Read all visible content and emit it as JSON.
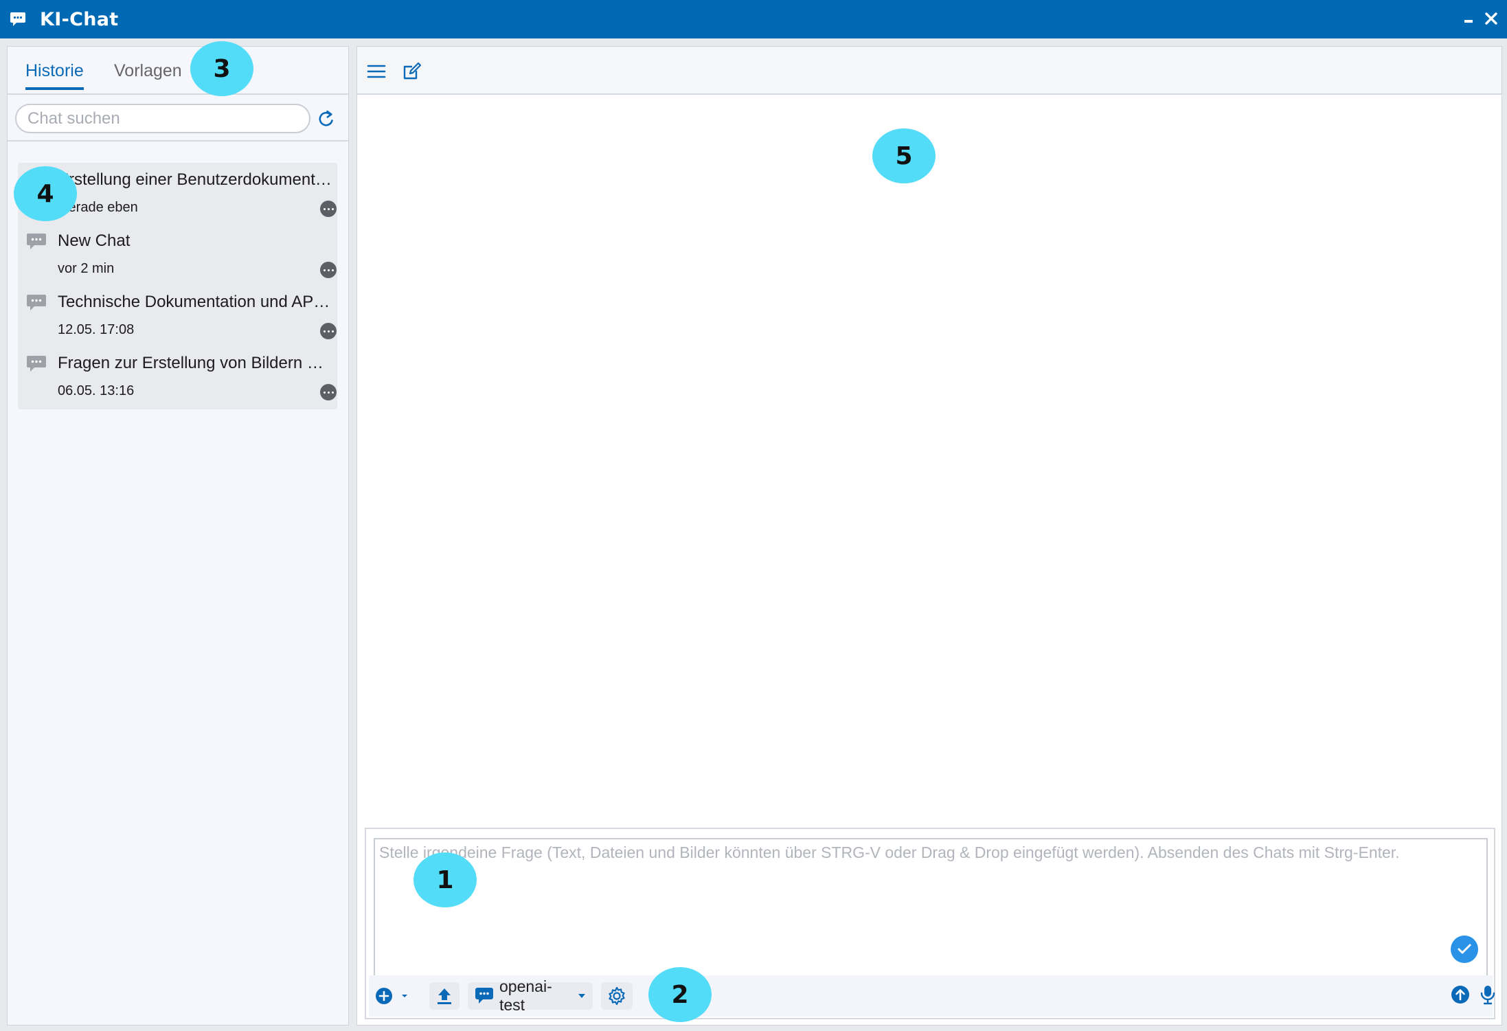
{
  "window": {
    "title": "KI-Chat",
    "app_icon": "chat-bubble-icon",
    "minimize_icon": "minimize-icon",
    "close_icon": "close-icon",
    "accent_color": "#0069b4"
  },
  "sidebar": {
    "tabs": [
      {
        "label": "Historie",
        "active": true
      },
      {
        "label": "Vorlagen",
        "active": false
      }
    ],
    "search": {
      "placeholder": "Chat suchen",
      "value": ""
    },
    "refresh_icon": "refresh-icon",
    "chats": [
      {
        "title": "Erstellung einer Benutzerdokumentation",
        "time": "Gerade eben",
        "icon": "chat-bubble-icon"
      },
      {
        "title": "New Chat",
        "time": "vor 2 min",
        "icon": "chat-bubble-icon"
      },
      {
        "title": "Technische Dokumentation und API-Referenz",
        "time": "12.05. 17:08",
        "icon": "chat-bubble-icon"
      },
      {
        "title": "Fragen zur Erstellung von Bildern mit KI",
        "time": "06.05. 13:16",
        "icon": "chat-bubble-icon"
      }
    ]
  },
  "main": {
    "toolbar": {
      "menu_icon": "hamburger-menu-icon",
      "new_chat_icon": "edit-icon"
    },
    "composer": {
      "placeholder": "Stelle irgendeine Frage (Text, Dateien und Bilder könnten über STRG-V oder Drag & Drop eingefügt werden). Absenden des Chats mit Strg-Enter.",
      "value": "",
      "model_label": "openai-test",
      "icons": [
        "add-circle-icon",
        "upload-icon",
        "chat-bubble-icon",
        "settings-gear-icon",
        "send-arrow-icon",
        "microphone-icon",
        "check-icon"
      ]
    }
  },
  "callouts": [
    "1",
    "2",
    "3",
    "4",
    "5"
  ]
}
